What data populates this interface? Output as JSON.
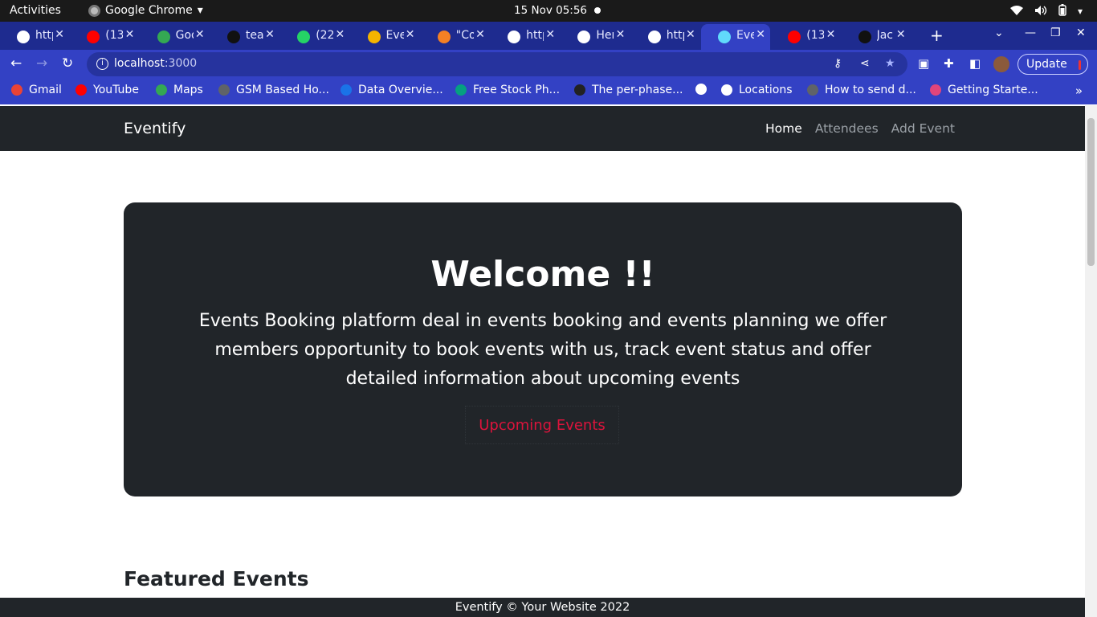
{
  "os_bar": {
    "activities": "Activities",
    "app_name": "Google Chrome",
    "clock": "15 Nov  05:56",
    "icons": [
      "wifi-icon",
      "volume-icon",
      "battery-icon",
      "chevron-down-icon"
    ]
  },
  "tabs": [
    {
      "title": "http",
      "favicon": "globe-icon",
      "color": "#ffffff"
    },
    {
      "title": "(13",
      "favicon": "youtube-icon",
      "color": "#ff0000"
    },
    {
      "title": "Goo",
      "favicon": "google-meet-icon",
      "color": "#34a853"
    },
    {
      "title": "tea",
      "favicon": "github-icon",
      "color": "#111111"
    },
    {
      "title": "(22",
      "favicon": "whatsapp-icon",
      "color": "#25d366"
    },
    {
      "title": "Eve",
      "favicon": "slides-icon",
      "color": "#f4b400"
    },
    {
      "title": "\"Co",
      "favicon": "stackoverflow-icon",
      "color": "#f48024"
    },
    {
      "title": "http",
      "favicon": "globe-icon",
      "color": "#ffffff"
    },
    {
      "title": "Her",
      "favicon": "globe-icon",
      "color": "#ffffff"
    },
    {
      "title": "http",
      "favicon": "globe-icon",
      "color": "#ffffff"
    },
    {
      "title": "Eve",
      "favicon": "react-icon",
      "color": "#61dafb",
      "active": true
    },
    {
      "title": "(13",
      "favicon": "youtube-icon",
      "color": "#ff0000"
    },
    {
      "title": "Jac",
      "favicon": "github-icon",
      "color": "#111111"
    }
  ],
  "toolbar": {
    "url_host": "localhost",
    "url_port": ":3000",
    "update_label": "Update"
  },
  "bookmarks": [
    {
      "label": "Gmail",
      "color": "#ea4335"
    },
    {
      "label": "YouTube",
      "color": "#ff0000"
    },
    {
      "label": "Maps",
      "color": "#34a853"
    },
    {
      "label": "GSM Based Ho...",
      "color": "#5f6368"
    },
    {
      "label": "Data Overvie...",
      "color": "#1a73e8"
    },
    {
      "label": "Free Stock Ph...",
      "color": "#05a081"
    },
    {
      "label": "The per-phase...",
      "color": "#222222"
    },
    {
      "label": "",
      "color": "#ffffff"
    },
    {
      "label": "Locations",
      "color": "#ffffff"
    },
    {
      "label": "How to send d...",
      "color": "#5f6368"
    },
    {
      "label": "Getting Starte...",
      "color": "#e0457b"
    }
  ],
  "site": {
    "brand": "Eventify",
    "nav": {
      "home": "Home",
      "attendees": "Attendees",
      "add_event": "Add Event"
    },
    "hero": {
      "title": "Welcome !!",
      "text": "Events Booking platform deal in events booking and events planning we offer members opportunity to book events with us, track event status and offer detailed information about upcoming events",
      "cta": "Upcoming Events"
    },
    "featured_heading": "Featured Events",
    "footer": "Eventify © Your Website 2022"
  },
  "colors": {
    "chrome_frame": "#1e2b8f",
    "chrome_toolbar": "#3341c4",
    "site_dark": "#212529",
    "cta_red": "#dc143c"
  }
}
